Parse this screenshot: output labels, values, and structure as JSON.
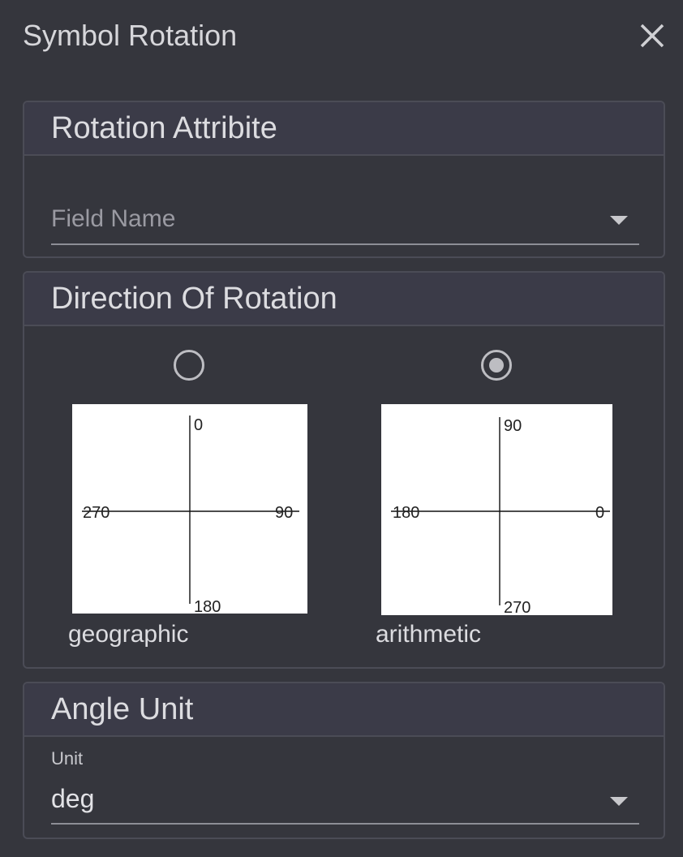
{
  "dialog": {
    "title": "Symbol Rotation",
    "close_icon": "close-icon"
  },
  "rotation_attribute": {
    "header": "Rotation Attribite",
    "field_placeholder": "Field Name",
    "field_value": ""
  },
  "direction": {
    "header": "Direction Of Rotation",
    "selected": "arithmetic",
    "options": [
      {
        "label": "geographic",
        "checked": false,
        "axis_labels": {
          "top": "0",
          "right": "90",
          "bottom": "180",
          "left": "270"
        }
      },
      {
        "label": "arithmetic",
        "checked": true,
        "axis_labels": {
          "top": "90",
          "right": "0",
          "bottom": "270",
          "left": "180"
        }
      }
    ]
  },
  "angle_unit": {
    "header": "Angle Unit",
    "unit_label": "Unit",
    "unit_value": "deg"
  },
  "colors": {
    "background": "#35363d",
    "panel_header": "#3b3b48",
    "border": "#4b4c56",
    "text": "#dcdce0"
  }
}
